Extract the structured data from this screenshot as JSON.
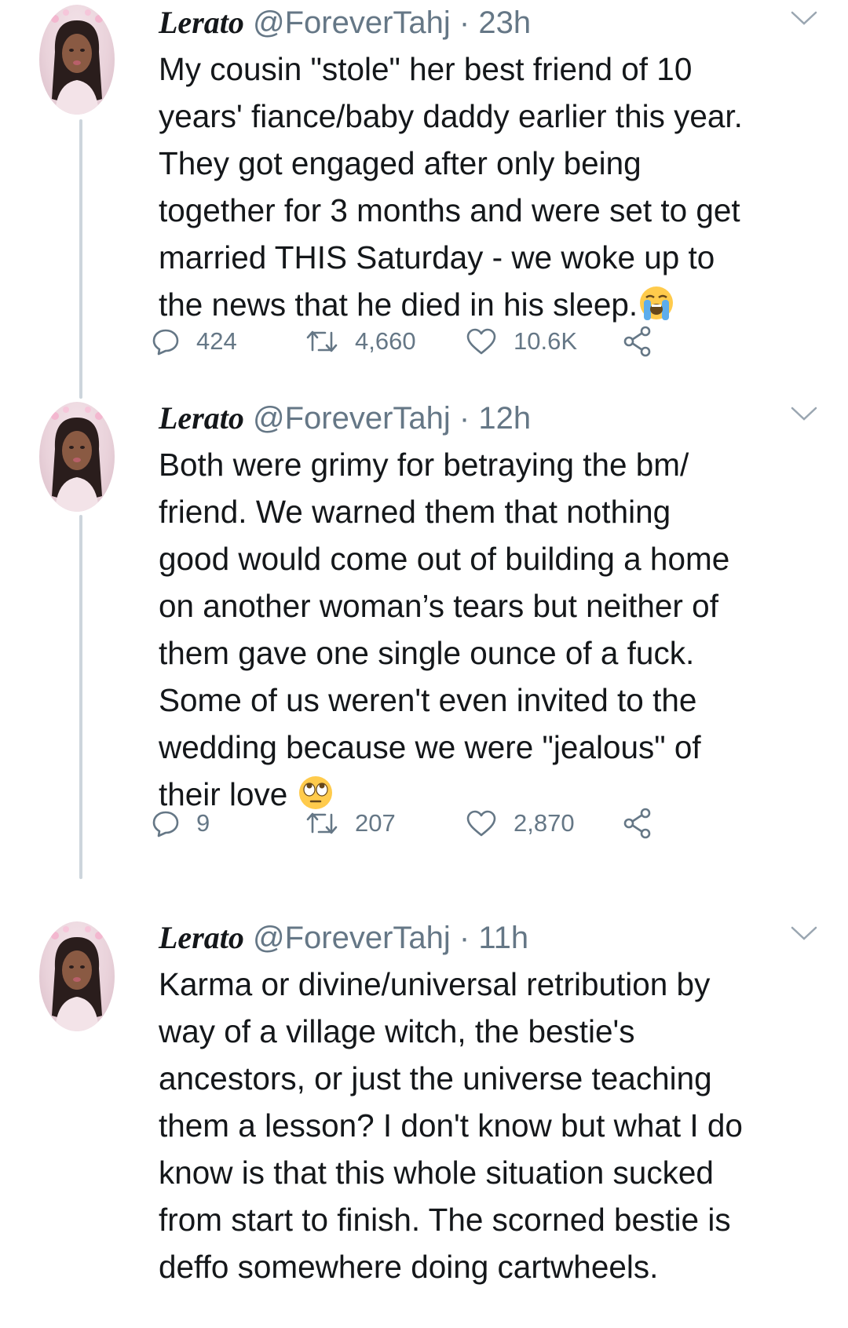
{
  "tweets": [
    {
      "name": "Lerato",
      "handle": "@ForeverTahj",
      "separator": "·",
      "time": "23h",
      "text": "My cousin \"stole\" her best friend of 10\nyears' fiance/baby daddy earlier this year.\nThey got engaged after only being\ntogether for 3 months and were set to get\nmarried THIS Saturday - we woke up to\nthe news that he died in his sleep.",
      "emoji": "loudly-crying-face",
      "replies": "424",
      "retweets": "4,660",
      "likes": "10.6K"
    },
    {
      "name": "Lerato",
      "handle": "@ForeverTahj",
      "separator": "·",
      "time": "12h",
      "text": "Both were grimy for betraying the bm/\nfriend. We warned them that nothing\ngood would come out of building a home\non another woman’s tears but neither of\nthem gave one single ounce of a fuck.\nSome of us weren't even invited to the\nwedding because we were \"jealous\" of\ntheir love ",
      "emoji": "face-with-rolling-eyes",
      "replies": "9",
      "retweets": "207",
      "likes": "2,870"
    },
    {
      "name": "Lerato",
      "handle": "@ForeverTahj",
      "separator": "·",
      "time": "11h",
      "text": "Karma or divine/universal retribution by\nway of a village witch, the bestie's\nancestors, or just the universe teaching\nthem a lesson? I don't know but what I do\nknow is that this whole situation sucked\nfrom start to finish. The scorned bestie is\ndeffo somewhere doing cartwheels."
    }
  ],
  "colors": {
    "text": "#14171a",
    "secondary": "#657786",
    "thread_line": "#cdd5dc"
  }
}
